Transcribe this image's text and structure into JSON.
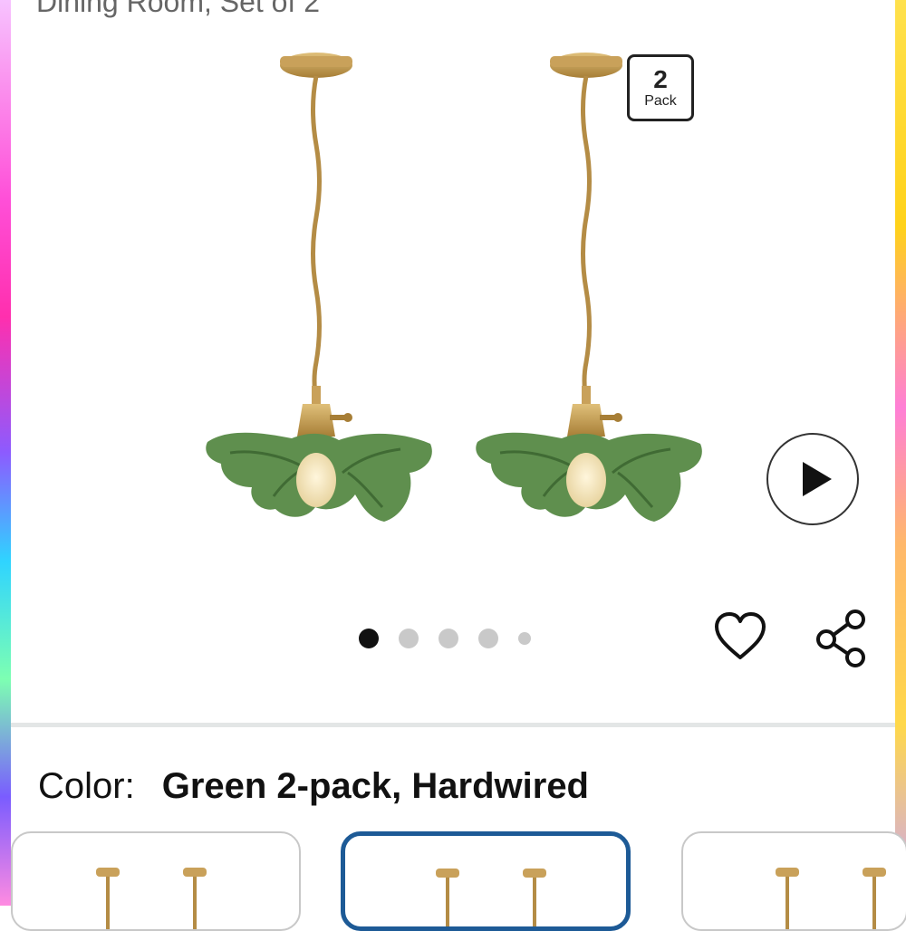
{
  "product": {
    "title_fragment": "Dining Room, Set of 2"
  },
  "badge": {
    "number": "2",
    "label": "Pack"
  },
  "gallery": {
    "dot_count": 5,
    "active_index": 0
  },
  "variant": {
    "label": "Color:",
    "value": "Green 2-pack, Hardwired"
  },
  "icons": {
    "play": "play-icon",
    "heart": "heart-icon",
    "share": "share-icon"
  },
  "colors": {
    "shade_green": "#5f8f4e",
    "brass": "#c9a15a",
    "selected_border": "#1d5a96"
  }
}
